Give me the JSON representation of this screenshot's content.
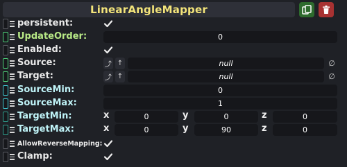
{
  "header": {
    "title": "LinearAngleMapper"
  },
  "fields": {
    "persistent": {
      "label": "persistent:"
    },
    "update_order": {
      "label": "UpdateOrder:",
      "value": "0"
    },
    "enabled": {
      "label": "Enabled:"
    },
    "source": {
      "label": "Source:",
      "value": "null"
    },
    "target": {
      "label": "Target:",
      "value": "null"
    },
    "source_min": {
      "label": "SourceMin:",
      "value": "0"
    },
    "source_max": {
      "label": "SourceMax:",
      "value": "1"
    },
    "target_min": {
      "label": "TargetMin:",
      "x_label": "x",
      "y_label": "y",
      "z_label": "z",
      "x": "0",
      "y": "0",
      "z": "0"
    },
    "target_max": {
      "label": "TargetMax:",
      "x_label": "x",
      "y_label": "y",
      "z_label": "z",
      "x": "0",
      "y": "90",
      "z": "0"
    },
    "allow_reverse_mapping": {
      "label": "AllowReverseMapping:"
    },
    "clamp": {
      "label": "Clamp:"
    }
  },
  "colors": {
    "title": "#f3e47a",
    "duplicate_button": "#2e6b2e",
    "delete_button": "#a83232",
    "background": "#1f2126"
  },
  "icons": {
    "duplicate": "duplicate-icon",
    "delete": "trash-icon",
    "set_reference": "set-reference-icon",
    "jump_to": "jump-up-icon",
    "clear": "clear-reference-icon",
    "checkbox": "checkmark-icon"
  }
}
